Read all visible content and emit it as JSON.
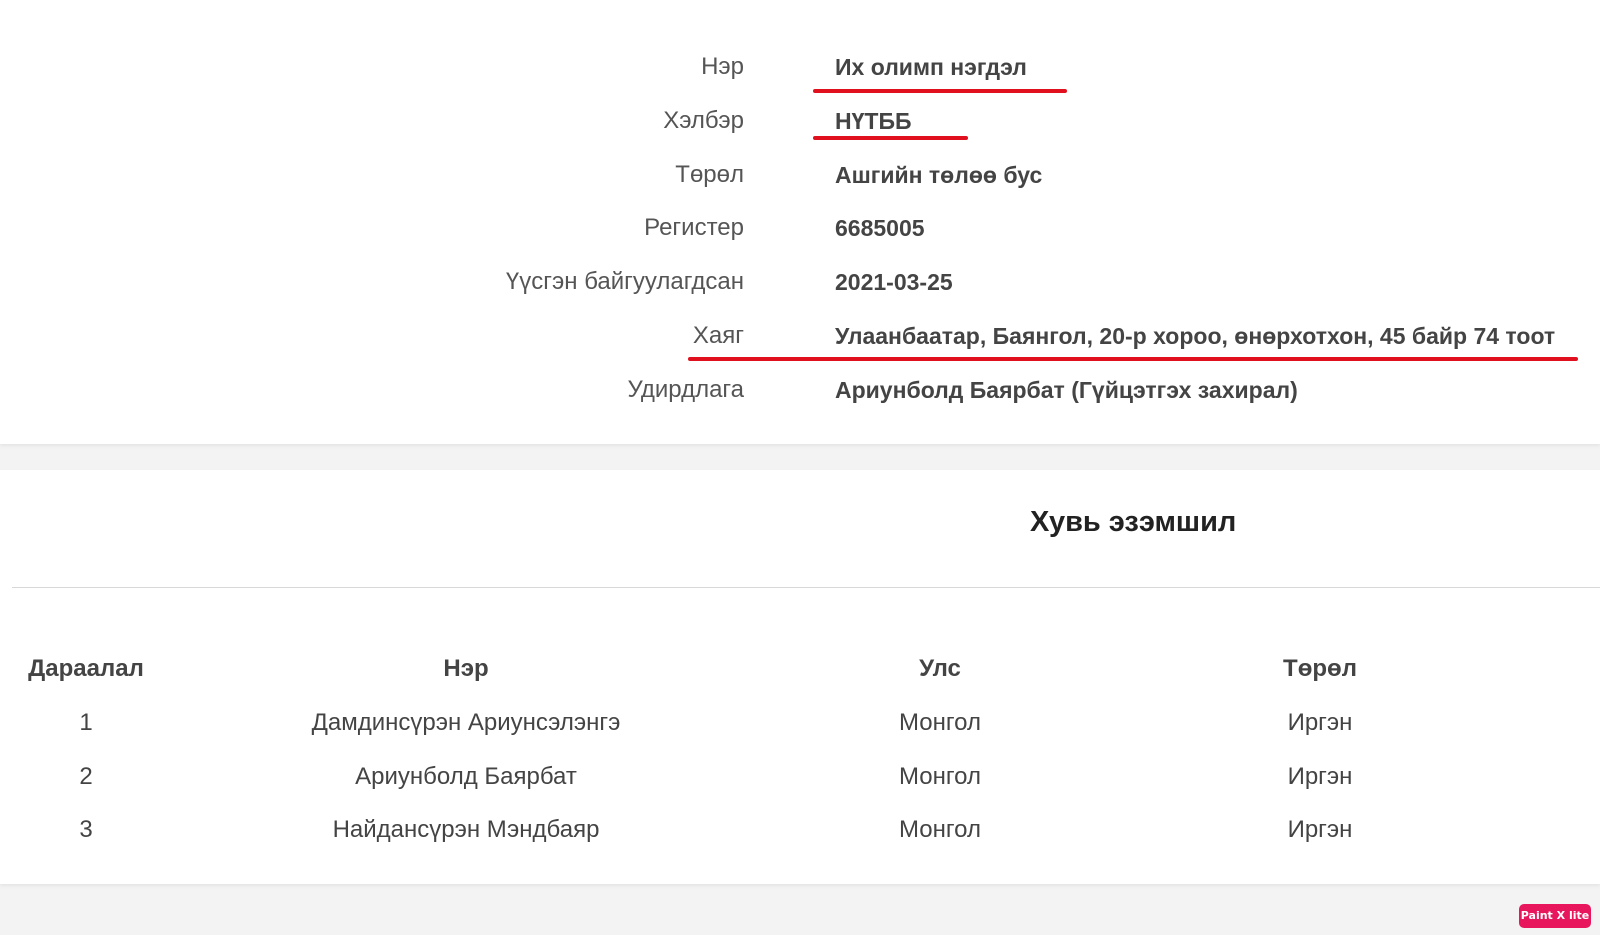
{
  "info": {
    "rows": [
      {
        "label": "Нэр",
        "value": "Их олимп нэгдэл"
      },
      {
        "label": "Хэлбэр",
        "value": "НҮТББ"
      },
      {
        "label": "Төрөл",
        "value": "Ашгийн төлөө бус"
      },
      {
        "label": "Регистер",
        "value": "6685005"
      },
      {
        "label": "Үүсгэн байгуулагдсан",
        "value": "2021-03-25"
      },
      {
        "label": "Хаяг",
        "value": "Улаанбаатар, Баянгол, 20-р хороо, өнөрхотхон, 45 байр 74 тоот"
      },
      {
        "label": "Удирдлага",
        "value": "Ариунболд Баярбат (Гүйцэтгэх захирал)"
      }
    ]
  },
  "ownership": {
    "title": "Хувь эзэмшил",
    "columns": [
      "Дараалал",
      "Нэр",
      "Улс",
      "Төрөл"
    ],
    "rows": [
      [
        "1",
        "Дамдинсүрэн Ариунсэлэнгэ",
        "Монгол",
        "Иргэн"
      ],
      [
        "2",
        "Ариунболд Баярбат",
        "Монгол",
        "Иргэн"
      ],
      [
        "3",
        "Найдансүрэн Мэндбаяр",
        "Монгол",
        "Иргэн"
      ]
    ]
  },
  "annotation_color": "#e0101e",
  "watermark": {
    "text": "Paint X lite",
    "color": "#e8175d"
  }
}
